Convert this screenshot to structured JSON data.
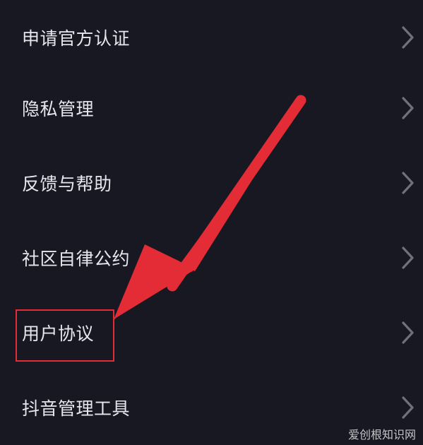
{
  "menu": {
    "items": [
      {
        "label": "申请官方认证"
      },
      {
        "label": "隐私管理"
      },
      {
        "label": "反馈与帮助"
      },
      {
        "label": "社区自律公约"
      },
      {
        "label": "用户协议"
      },
      {
        "label": "抖音管理工具"
      }
    ]
  },
  "icons": {
    "row_chevron": "chevron-right-icon",
    "annotation": "red-arrow-icon"
  },
  "colors": {
    "background": "#171822",
    "text": "#e6e7ee",
    "chevron": "#6f717c",
    "annotation_red": "#e32c35"
  },
  "watermark": {
    "text": "爱创根知识网"
  }
}
